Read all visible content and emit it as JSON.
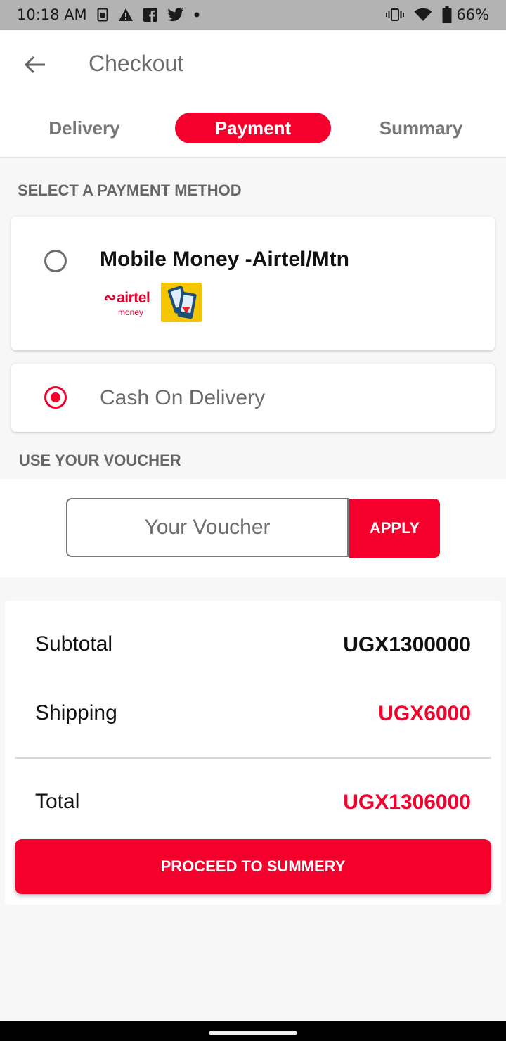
{
  "status_bar": {
    "time": "10:18 AM",
    "battery": "66%",
    "left_icons": [
      "sim-icon",
      "warning-icon",
      "facebook-icon",
      "twitter-icon",
      "dot-icon"
    ],
    "right_icons": [
      "vibrate-icon",
      "wifi-icon",
      "battery-icon"
    ]
  },
  "header": {
    "title": "Checkout",
    "back_icon": "arrow-left-icon"
  },
  "tabs": [
    {
      "label": "Delivery",
      "active": false
    },
    {
      "label": "Payment",
      "active": true
    },
    {
      "label": "Summary",
      "active": false
    }
  ],
  "payment": {
    "section_label": "SELECT A PAYMENT METHOD",
    "methods": [
      {
        "label": "Mobile Money -Airtel/Mtn",
        "selected": false,
        "logo_text": "airtel",
        "logo_sub": "money"
      },
      {
        "label": "Cash On Delivery",
        "selected": true
      }
    ]
  },
  "voucher": {
    "section_label": "USE YOUR VOUCHER",
    "placeholder": "Your Voucher",
    "value": "",
    "apply_label": "APPLY"
  },
  "totals": {
    "subtotal_label": "Subtotal",
    "subtotal_value": "UGX1300000",
    "shipping_label": "Shipping",
    "shipping_value": "UGX6000",
    "total_label": "Total",
    "total_value": "UGX1306000"
  },
  "proceed_label": "PROCEED TO SUMMERY",
  "colors": {
    "accent": "#f5002d",
    "status_bar": "#b3b3b3",
    "muted_text": "#6b6b6b"
  }
}
